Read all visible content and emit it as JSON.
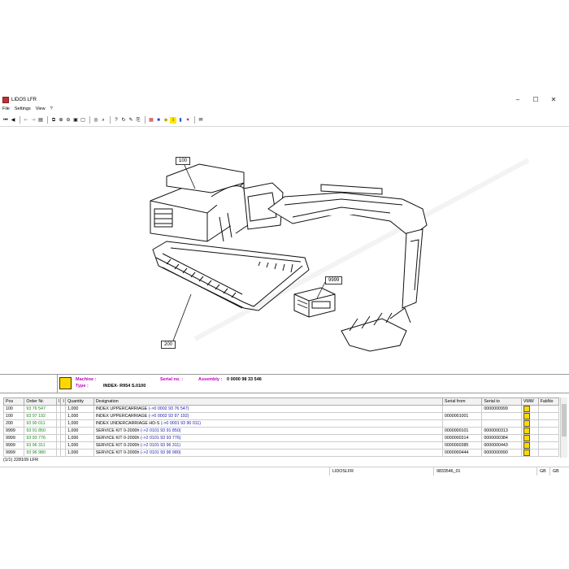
{
  "window": {
    "title": "LIDOS LFR",
    "minimize": "–",
    "maximize": "☐",
    "close": "✕"
  },
  "menu": [
    "File",
    "Settings",
    "View",
    "?"
  ],
  "toolbar_icons": [
    "first-icon",
    "prev-icon",
    "back-icon",
    "forward-icon",
    "print-icon",
    "copy-icon",
    "zoom-in-icon",
    "zoom-out-icon",
    "fit-icon",
    "page-icon",
    "find-icon",
    "search-icon",
    "help-icon",
    "refresh-icon",
    "edit-icon",
    "export-icon",
    "grid-icon",
    "color-icon",
    "mark-icon",
    "info-icon",
    "book-icon",
    "heart-icon",
    "mail-icon"
  ],
  "callouts": {
    "c100": "100",
    "c200": "200",
    "c9999": "9999"
  },
  "info": {
    "machine_label": "Machine :",
    "type_label": "Type :",
    "type_value": "INDEX- R954 S.0100",
    "serial_label": "Serial no. :",
    "assembly_label": "Assembly :",
    "assembly_value": "0 0000 98 33 546"
  },
  "table": {
    "headers": [
      "Pos",
      "Order Nr.",
      "I",
      "I",
      "Quantity",
      "Designation",
      "Serial from",
      "Serial to",
      "VMW",
      "FabNo"
    ],
    "rows": [
      {
        "pos": "100",
        "order": "93 76 547",
        "qty": "1,000",
        "desig": "INDEX UPPERCARRIAGE",
        "ref": "(->0 0002 93 76 547)",
        "from": "",
        "to": "0000000999"
      },
      {
        "pos": "100",
        "order": "93 97 192",
        "qty": "1,000",
        "desig": "INDEX UPPERCARRIAGE",
        "ref": "(->0 0002 93 97 192)",
        "from": "0000001001",
        "to": ""
      },
      {
        "pos": "200",
        "order": "93 90 011",
        "qty": "1,000",
        "desig": "INDEX UNDERCARRIAGE HD-S",
        "ref": "(->0 0001 93 90 011)",
        "from": "",
        "to": ""
      },
      {
        "pos": "9999",
        "order": "93 91 850",
        "qty": "1,000",
        "desig": "SERVICE KIT 0-2000h",
        "ref": "(->2 0101 93 91 850)",
        "from": "0000000101",
        "to": "0000000313"
      },
      {
        "pos": "9999",
        "order": "93 93 776",
        "qty": "1,000",
        "desig": "SERVICE KIT 0-2000h",
        "ref": "(->2 0101 93 93 776)",
        "from": "0000000314",
        "to": "0000000384"
      },
      {
        "pos": "9999",
        "order": "93 96 311",
        "qty": "1,000",
        "desig": "SERVICE KIT 0-2000h",
        "ref": "(->2 0101 93 96 311)",
        "from": "0000000385",
        "to": "0000000443"
      },
      {
        "pos": "9999",
        "order": "93 96 980",
        "qty": "1,000",
        "desig": "SERVICE KIT 0-2000h",
        "ref": "(->2 0101 93 96 980)",
        "from": "0000000444",
        "to": "0000000990"
      }
    ]
  },
  "status": {
    "count": "(1/1) 228109 LFR",
    "app": "LIDOSLFR",
    "doc": "9833546_01",
    "lang1": "GB",
    "lang2": "GB"
  },
  "colors": {
    "order_green": "#1a8a1a",
    "ref_blue": "#1a1ab0",
    "label_magenta": "#c000c0"
  }
}
